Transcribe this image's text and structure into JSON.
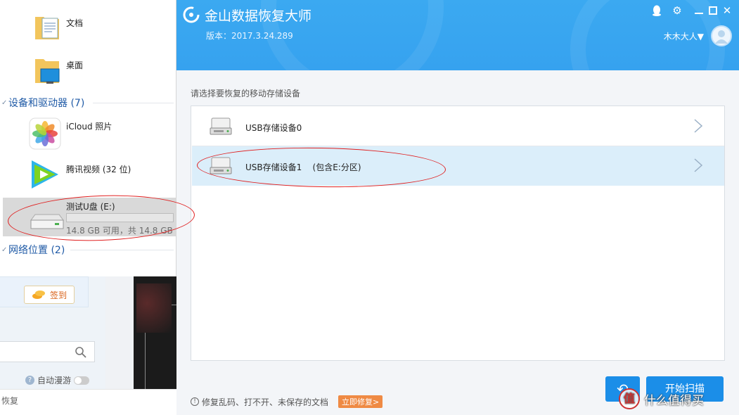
{
  "explorer": {
    "items_top": [
      {
        "label": "文档"
      },
      {
        "label": "桌面"
      }
    ],
    "devices_section": "设备和驱动器 (7)",
    "devices": [
      {
        "label": "iCloud 照片"
      },
      {
        "label": "腾讯视频 (32 位)"
      }
    ],
    "drive": {
      "label": "测试U盘 (E:)",
      "usage_fraction": 0.0,
      "capacity": "14.8 GB 可用，共 14.8 GB"
    },
    "network_section": "网络位置 (2)"
  },
  "background_app": {
    "signin_label": "签到",
    "autoroam_label": "自动漫游",
    "bottom_text": "恢复"
  },
  "app": {
    "title": "金山数据恢复大师",
    "version": "版本：2017.3.24.289",
    "user": "木木大人▼",
    "prompt": "请选择要恢复的移动存储设备",
    "devices": [
      {
        "label": "USB存储设备0"
      },
      {
        "label": "USB存储设备1    (包含E:分区)"
      }
    ],
    "footer_tip": "修复乱码、打不开、未保存的文档",
    "fix_now": "立即修复>",
    "back_label": "↶",
    "start_label": "开始扫描"
  },
  "watermark": {
    "badge": "值",
    "text": "什么值得买"
  },
  "colors": {
    "accent": "#36a2ef",
    "button": "#1b8ee8",
    "selected_row": "#dbeefa",
    "annotation": "#e01e1e",
    "fix_badge": "#ef8a44"
  }
}
